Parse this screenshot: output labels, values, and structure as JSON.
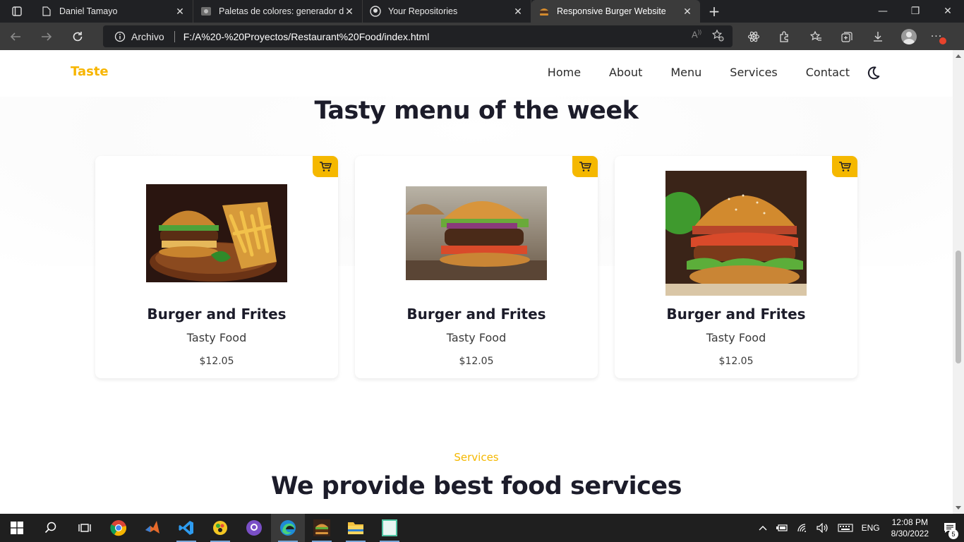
{
  "browser": {
    "tabs": [
      {
        "title": "Daniel Tamayo",
        "icon": "document-icon"
      },
      {
        "title": "Paletas de colores: generador de",
        "icon": "palette-icon"
      },
      {
        "title": "Your Repositories",
        "icon": "github-icon"
      },
      {
        "title": "Responsive Burger Website",
        "icon": "burger-icon",
        "active": true
      }
    ],
    "address": {
      "label": "Archivo",
      "url": "F:/A%20-%20Proyectos/Restaurant%20Food/index.html"
    }
  },
  "site": {
    "logo": "Taste",
    "nav": [
      "Home",
      "About",
      "Menu",
      "Services",
      "Contact"
    ],
    "accent_color": "#f5b800"
  },
  "menu_section": {
    "title": "Tasty menu of the week",
    "cards": [
      {
        "name": "Burger and Frites",
        "subtitle": "Tasty Food",
        "price": "$12.05"
      },
      {
        "name": "Burger and Frites",
        "subtitle": "Tasty Food",
        "price": "$12.05"
      },
      {
        "name": "Burger and Frites",
        "subtitle": "Tasty Food",
        "price": "$12.05"
      }
    ]
  },
  "services_section": {
    "subtitle": "Services",
    "title": "We provide best food services"
  },
  "taskbar": {
    "language": "ENG",
    "time": "12:08 PM",
    "date": "8/30/2022",
    "notification_count": "5"
  }
}
